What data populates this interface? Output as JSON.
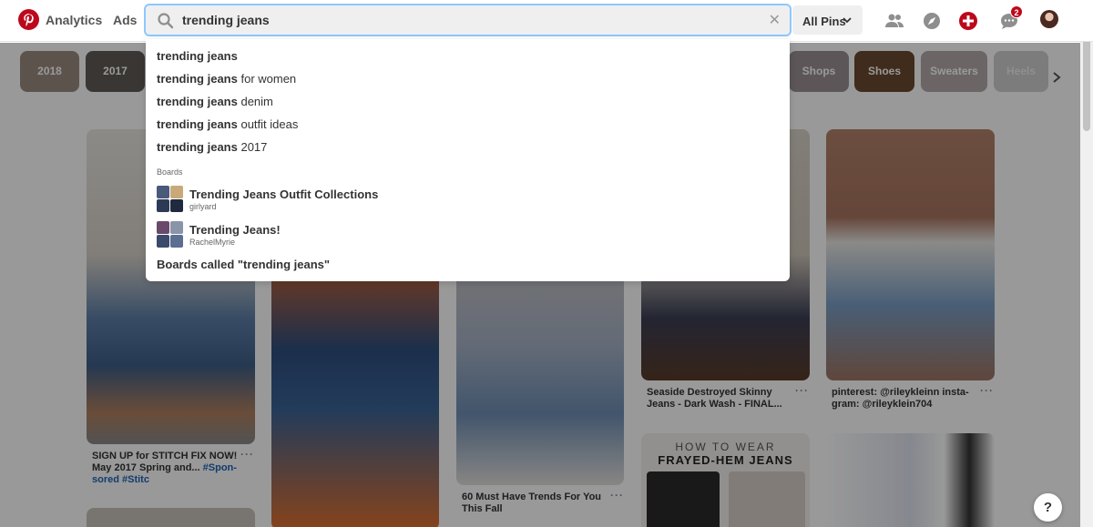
{
  "header": {
    "nav": [
      "Analytics",
      "Ads"
    ],
    "search": {
      "value": "trending jeans",
      "placeholder": "Search"
    },
    "scope": "All Pins",
    "notification_count": "2"
  },
  "chips": [
    "2018",
    "2017",
    "Shops",
    "Shoes",
    "Sweaters",
    "Heels"
  ],
  "pins": [
    {
      "title": "SIGN UP for STITCH FIX NOW! May 2017 Spring and... ",
      "tag": "#Spon-sored #Stitc",
      "more": "···"
    },
    {
      "title": "60 Must Have Trends For You This Fall",
      "more": "···"
    },
    {
      "title": "Seaside Destroyed Skinny Jeans - Dark Wash - FINAL...",
      "more": "···"
    },
    {
      "title": "pinterest: @rileykleinn insta-gram: @rileyklein704",
      "more": "···"
    },
    {
      "overlay_line1": "HOW TO WEAR",
      "overlay_line2": "FRAYED-HEM JEANS"
    }
  ],
  "dropdown": {
    "suggestions": [
      {
        "bold": "trending jeans",
        "rest": ""
      },
      {
        "bold": "trending jeans",
        "rest": " for women"
      },
      {
        "bold": "trending jeans",
        "rest": " denim"
      },
      {
        "bold": "trending jeans",
        "rest": " outfit ideas"
      },
      {
        "bold": "trending jeans",
        "rest": " 2017"
      }
    ],
    "boards_heading": "Boards",
    "boards": [
      {
        "name": "Trending Jeans Outfit Collections",
        "owner": "girlyard"
      },
      {
        "name": "Trending Jeans!",
        "owner": "RachelMyrie"
      }
    ],
    "boards_called": "Boards called \"trending jeans\""
  },
  "help": "?",
  "colors": {
    "brand": "#bd081c",
    "focus_ring": "#8cc8ff",
    "hashtag": "#1e63b8"
  }
}
